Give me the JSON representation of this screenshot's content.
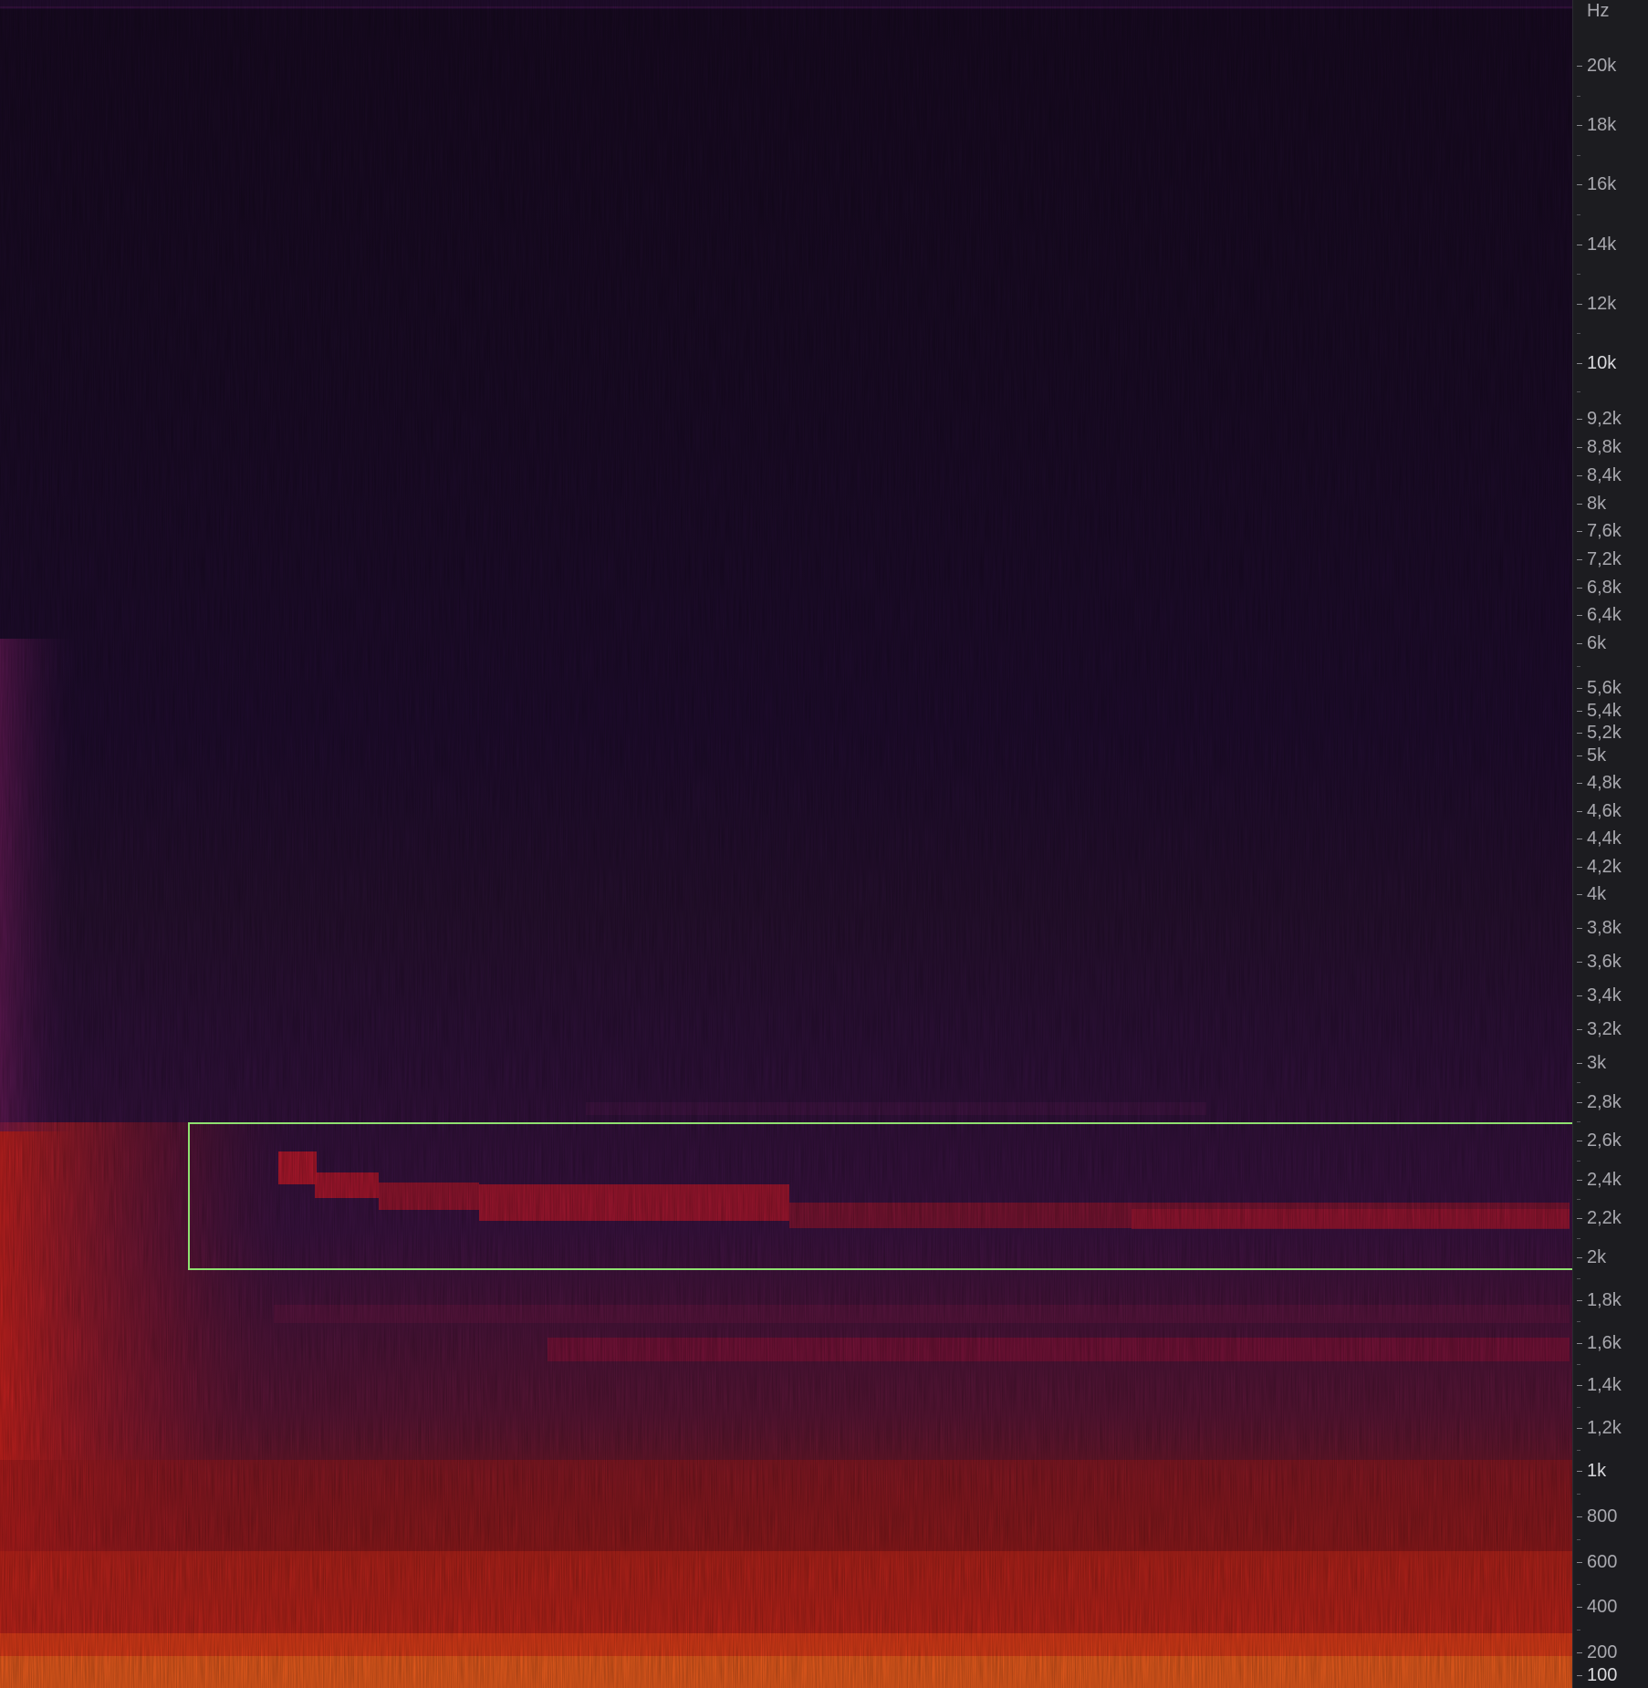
{
  "axis": {
    "unit": "Hz",
    "ticks": [
      {
        "label": "20k",
        "hz": 20000
      },
      {
        "label": "18k",
        "hz": 18000
      },
      {
        "label": "16k",
        "hz": 16000
      },
      {
        "label": "14k",
        "hz": 14000
      },
      {
        "label": "12k",
        "hz": 12000
      },
      {
        "label": "10k",
        "hz": 10000,
        "major": true
      },
      {
        "label": "9,2k",
        "hz": 9200
      },
      {
        "label": "8,8k",
        "hz": 8800
      },
      {
        "label": "8,4k",
        "hz": 8400
      },
      {
        "label": "8k",
        "hz": 8000
      },
      {
        "label": "7,6k",
        "hz": 7600
      },
      {
        "label": "7,2k",
        "hz": 7200
      },
      {
        "label": "6,8k",
        "hz": 6800
      },
      {
        "label": "6,4k",
        "hz": 6400
      },
      {
        "label": "6k",
        "hz": 6000
      },
      {
        "label": "5,6k",
        "hz": 5600
      },
      {
        "label": "5,4k",
        "hz": 5400
      },
      {
        "label": "5,2k",
        "hz": 5200
      },
      {
        "label": "5k",
        "hz": 5000
      },
      {
        "label": "4,8k",
        "hz": 4800
      },
      {
        "label": "4,6k",
        "hz": 4600
      },
      {
        "label": "4,4k",
        "hz": 4400
      },
      {
        "label": "4,2k",
        "hz": 4200
      },
      {
        "label": "4k",
        "hz": 4000
      },
      {
        "label": "3,8k",
        "hz": 3800
      },
      {
        "label": "3,6k",
        "hz": 3600
      },
      {
        "label": "3,4k",
        "hz": 3400
      },
      {
        "label": "3,2k",
        "hz": 3200
      },
      {
        "label": "3k",
        "hz": 3000
      },
      {
        "label": "2,8k",
        "hz": 2800
      },
      {
        "label": "2,6k",
        "hz": 2600
      },
      {
        "label": "2,4k",
        "hz": 2400
      },
      {
        "label": "2,2k",
        "hz": 2200
      },
      {
        "label": "2k",
        "hz": 2000
      },
      {
        "label": "1,8k",
        "hz": 1800
      },
      {
        "label": "1,6k",
        "hz": 1600
      },
      {
        "label": "1,4k",
        "hz": 1400
      },
      {
        "label": "1,2k",
        "hz": 1200
      },
      {
        "label": "1k",
        "hz": 1000,
        "major": true
      },
      {
        "label": "800",
        "hz": 800
      },
      {
        "label": "600",
        "hz": 600
      },
      {
        "label": "400",
        "hz": 400
      },
      {
        "label": "200",
        "hz": 200
      },
      {
        "label": "100",
        "hz": 100,
        "major": true
      }
    ]
  },
  "selection": {
    "low_hz": 2000,
    "high_hz": 2600,
    "color": "#8fe070"
  },
  "colors": {
    "background": "#180a22",
    "low_energy": "#2a0f3a",
    "mid_energy": "#a01828",
    "high_energy": "#e8401a",
    "peak_energy": "#ffb020"
  }
}
